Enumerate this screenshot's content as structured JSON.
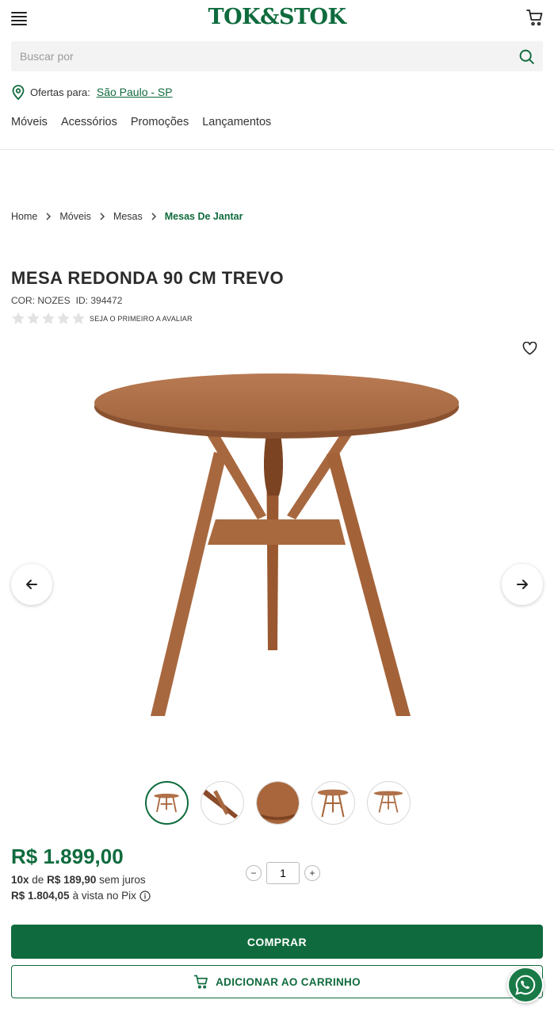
{
  "header": {
    "logo_text": "TOK&STOK",
    "menu_icon": "hamburger-menu-icon",
    "cart_icon": "cart-icon"
  },
  "search": {
    "placeholder": "Buscar por",
    "icon": "search-icon"
  },
  "location": {
    "label": "Ofertas para:",
    "value": "São Paulo - SP",
    "icon": "location-pin-icon"
  },
  "nav": {
    "items": [
      "Móveis",
      "Acessórios",
      "Promoções",
      "Lançamentos"
    ]
  },
  "breadcrumb": {
    "items": [
      "Home",
      "Móveis",
      "Mesas",
      "Mesas De Jantar"
    ]
  },
  "product": {
    "title": "MESA REDONDA 90 CM TREVO",
    "color": "COR: NOZES",
    "id": "ID: 394472",
    "rating_value": 0,
    "rating_max": 5,
    "review_cta": "SEJA O PRIMEIRO A AVALIAR",
    "favorite_icon": "heart-icon"
  },
  "gallery": {
    "thumbnail_count": 5,
    "active_index": 0
  },
  "pricing": {
    "price": "R$ 1.899,00",
    "installment_count": "10x",
    "installment_of": "de",
    "installment_value": "R$ 189,90",
    "installment_suffix": "sem juros",
    "pix_price": "R$ 1.804,05",
    "pix_suffix": "à vista no Pix"
  },
  "quantity": {
    "value": "1",
    "minus": "−",
    "plus": "+"
  },
  "actions": {
    "buy_label": "COMPRAR",
    "add_to_cart_label": "ADICIONAR AO CARRINHO"
  },
  "colors": {
    "brand_green": "#0f6b3d",
    "wood": "#a8683f"
  }
}
